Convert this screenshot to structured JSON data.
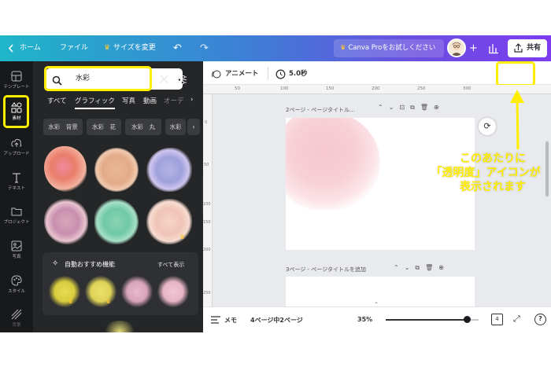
{
  "topbar": {
    "home": "ホーム",
    "file": "ファイル",
    "resize": "サイズを変更",
    "canva_pro": "Canva Proをお試しください",
    "share": "共有"
  },
  "rail": {
    "items": [
      {
        "label": "テンプレート"
      },
      {
        "label": "素材"
      },
      {
        "label": "アップロード"
      },
      {
        "label": "テキスト"
      },
      {
        "label": "プロジェクト"
      },
      {
        "label": "写真"
      },
      {
        "label": "スタイル"
      },
      {
        "label": "背景"
      }
    ]
  },
  "panel": {
    "search_value": "水彩",
    "tabs": [
      "すべて",
      "グラフィック",
      "写真",
      "動画",
      "オーデ"
    ],
    "chips": [
      "水彩　背景",
      "水彩　花",
      "水彩　丸",
      "水彩"
    ],
    "section_title": "自動おすすめ機能",
    "see_all": "すべて表示"
  },
  "toolbar": {
    "animate": "アニメート",
    "duration": "5.0秒"
  },
  "rulers": {
    "top": [
      "50",
      "100",
      "150",
      "200",
      "250",
      "300"
    ],
    "left": [
      "0",
      "50",
      "100",
      "150",
      "200",
      "250"
    ]
  },
  "pages": {
    "page2_label": "2ページ - ページタイトル...",
    "page3_label": "3ページ - ページタイトルを追加"
  },
  "bottombar": {
    "memo": "メモ",
    "page_count": "4ページ中2ページ",
    "zoom": "35%",
    "zoom_value": 0.35,
    "help": "?",
    "grid_count": "4"
  },
  "annotation": {
    "lines": [
      "このあたりに",
      "「透明度」アイコンが",
      "表示されます"
    ]
  },
  "colors": {
    "highlight": "#ffee00",
    "rail_bg": "#18191b",
    "panel_bg": "#252627"
  }
}
